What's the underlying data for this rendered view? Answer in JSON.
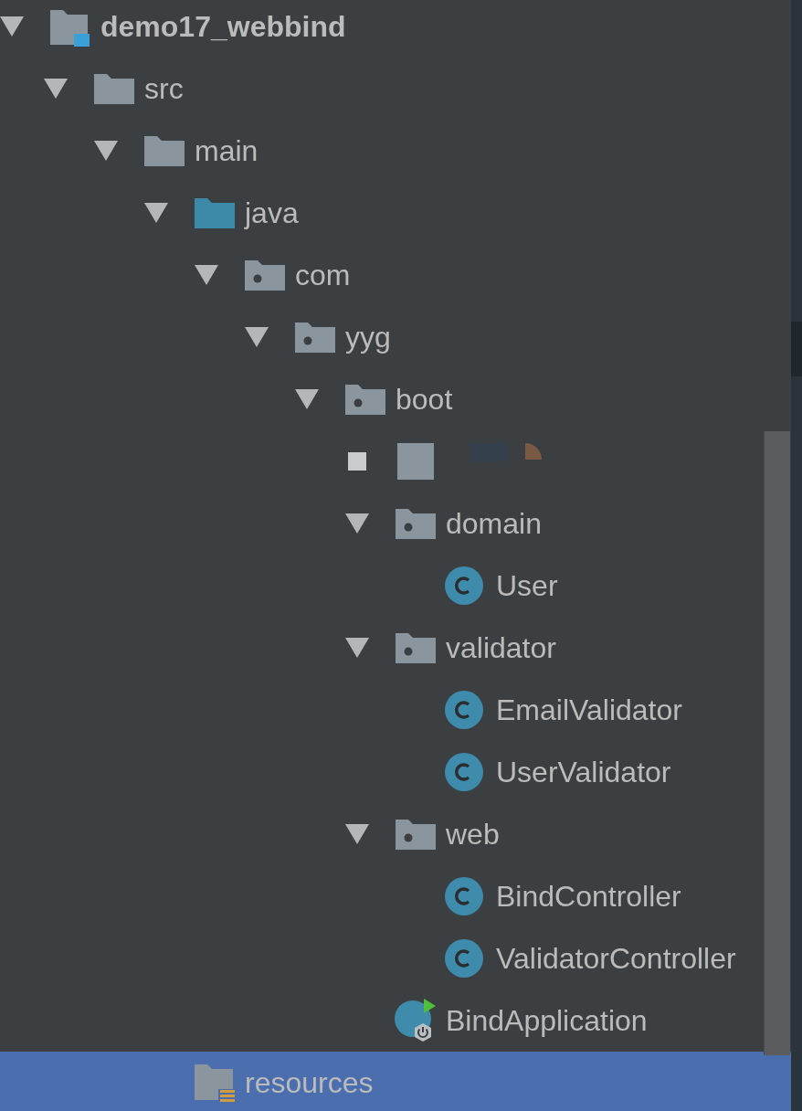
{
  "project_tree": {
    "nodes": [
      {
        "label": "demo17_webbind",
        "kind": "module",
        "expanded": true,
        "selected": false,
        "children": [
          {
            "label": "src",
            "kind": "folder",
            "expanded": true,
            "selected": false,
            "children": [
              {
                "label": "main",
                "kind": "folder",
                "expanded": true,
                "selected": false,
                "children": [
                  {
                    "label": "java",
                    "kind": "source-folder",
                    "expanded": true,
                    "selected": false,
                    "children": [
                      {
                        "label": "com",
                        "kind": "package",
                        "expanded": true,
                        "selected": false,
                        "children": [
                          {
                            "label": "yyg",
                            "kind": "package",
                            "expanded": true,
                            "selected": false,
                            "children": [
                              {
                                "label": "boot",
                                "kind": "package",
                                "expanded": true,
                                "selected": false,
                                "children": [
                                  {
                                    "kind": "redacted",
                                    "selected": false
                                  },
                                  {
                                    "label": "domain",
                                    "kind": "package",
                                    "expanded": true,
                                    "selected": false,
                                    "children": [
                                      {
                                        "label": "User",
                                        "kind": "class",
                                        "selected": false
                                      }
                                    ]
                                  },
                                  {
                                    "label": "validator",
                                    "kind": "package",
                                    "expanded": true,
                                    "selected": false,
                                    "children": [
                                      {
                                        "label": "EmailValidator",
                                        "kind": "class",
                                        "selected": false
                                      },
                                      {
                                        "label": "UserValidator",
                                        "kind": "class",
                                        "selected": false
                                      }
                                    ]
                                  },
                                  {
                                    "label": "web",
                                    "kind": "package",
                                    "expanded": true,
                                    "selected": false,
                                    "children": [
                                      {
                                        "label": "BindController",
                                        "kind": "class",
                                        "selected": false
                                      },
                                      {
                                        "label": "ValidatorController",
                                        "kind": "class",
                                        "selected": false
                                      }
                                    ]
                                  },
                                  {
                                    "label": "BindApplication",
                                    "kind": "app-class",
                                    "selected": false
                                  }
                                ]
                              }
                            ]
                          }
                        ]
                      }
                    ]
                  },
                  {
                    "label": "resources",
                    "kind": "resources",
                    "selected": true
                  }
                ]
              }
            ]
          }
        ]
      }
    ]
  }
}
